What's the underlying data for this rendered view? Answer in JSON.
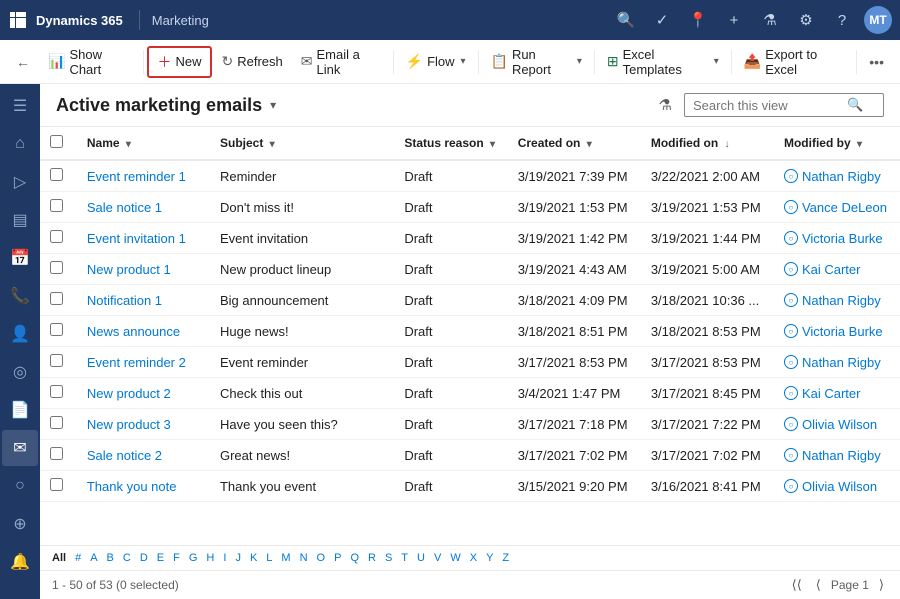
{
  "topbar": {
    "app": "Dynamics 365",
    "module": "Marketing",
    "avatar": "MT"
  },
  "cmdbar": {
    "back_label": "←",
    "show_chart_label": "Show Chart",
    "new_label": "New",
    "refresh_label": "Refresh",
    "email_link_label": "Email a Link",
    "flow_label": "Flow",
    "run_report_label": "Run Report",
    "excel_templates_label": "Excel Templates",
    "export_excel_label": "Export to Excel"
  },
  "view": {
    "title": "Active marketing emails",
    "search_placeholder": "Search this view"
  },
  "table": {
    "columns": [
      "Name",
      "Subject",
      "Status reason",
      "Created on",
      "Modified on",
      "Modified by"
    ],
    "rows": [
      {
        "name": "Event reminder 1",
        "subject": "Reminder",
        "status": "Draft",
        "created": "3/19/2021 7:39 PM",
        "modified": "3/22/2021 2:00 AM",
        "modified_by": "Nathan Rigby"
      },
      {
        "name": "Sale notice 1",
        "subject": "Don't miss it!",
        "status": "Draft",
        "created": "3/19/2021 1:53 PM",
        "modified": "3/19/2021 1:53 PM",
        "modified_by": "Vance DeLeon"
      },
      {
        "name": "Event invitation 1",
        "subject": "Event invitation",
        "status": "Draft",
        "created": "3/19/2021 1:42 PM",
        "modified": "3/19/2021 1:44 PM",
        "modified_by": "Victoria Burke"
      },
      {
        "name": "New product 1",
        "subject": "New product lineup",
        "status": "Draft",
        "created": "3/19/2021 4:43 AM",
        "modified": "3/19/2021 5:00 AM",
        "modified_by": "Kai Carter"
      },
      {
        "name": "Notification 1",
        "subject": "Big announcement",
        "status": "Draft",
        "created": "3/18/2021 4:09 PM",
        "modified": "3/18/2021 10:36 ...",
        "modified_by": "Nathan Rigby"
      },
      {
        "name": "News announce",
        "subject": "Huge news!",
        "status": "Draft",
        "created": "3/18/2021 8:51 PM",
        "modified": "3/18/2021 8:53 PM",
        "modified_by": "Victoria Burke"
      },
      {
        "name": "Event reminder 2",
        "subject": "Event reminder",
        "status": "Draft",
        "created": "3/17/2021 8:53 PM",
        "modified": "3/17/2021 8:53 PM",
        "modified_by": "Nathan Rigby"
      },
      {
        "name": "New product 2",
        "subject": "Check this out",
        "status": "Draft",
        "created": "3/4/2021 1:47 PM",
        "modified": "3/17/2021 8:45 PM",
        "modified_by": "Kai Carter"
      },
      {
        "name": "New product 3",
        "subject": "Have you seen this?",
        "status": "Draft",
        "created": "3/17/2021 7:18 PM",
        "modified": "3/17/2021 7:22 PM",
        "modified_by": "Olivia Wilson"
      },
      {
        "name": "Sale notice 2",
        "subject": "Great news!",
        "status": "Draft",
        "created": "3/17/2021 7:02 PM",
        "modified": "3/17/2021 7:02 PM",
        "modified_by": "Nathan Rigby"
      },
      {
        "name": "Thank you note",
        "subject": "Thank you event",
        "status": "Draft",
        "created": "3/15/2021 9:20 PM",
        "modified": "3/16/2021 8:41 PM",
        "modified_by": "Olivia Wilson"
      }
    ]
  },
  "alphabet": [
    "All",
    "#",
    "A",
    "B",
    "C",
    "D",
    "E",
    "F",
    "G",
    "H",
    "I",
    "J",
    "K",
    "L",
    "M",
    "N",
    "O",
    "P",
    "Q",
    "R",
    "S",
    "T",
    "U",
    "V",
    "W",
    "X",
    "Y",
    "Z"
  ],
  "statusbar": {
    "count": "1 - 50 of 53 (0 selected)",
    "page_label": "Page 1"
  },
  "sidebar": {
    "icons": [
      "☰",
      "🏠",
      "▷",
      "☰",
      "📅",
      "📞",
      "👤",
      "🎯",
      "📄",
      "✉",
      "🔵",
      "⊕",
      "🔔"
    ]
  }
}
